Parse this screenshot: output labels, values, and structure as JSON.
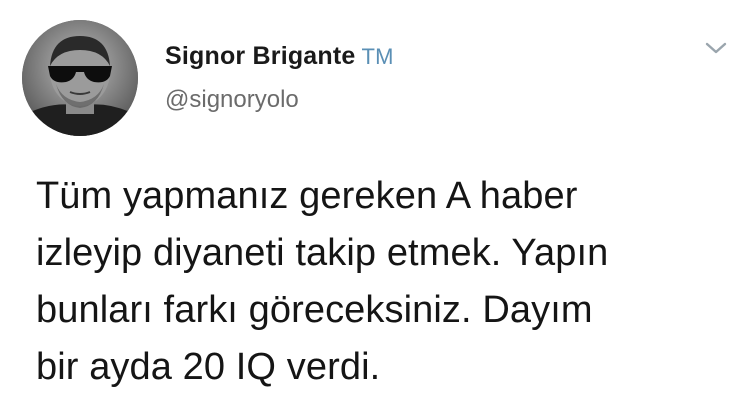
{
  "tweet": {
    "author": {
      "display_name": "Signor Brigante",
      "badge": "TM",
      "handle": "@signoryolo",
      "avatar_icon": "profile-photo-man-sunglasses",
      "badge_color": "#5a8fb5"
    },
    "menu_icon": "chevron-down-icon",
    "text": "Tüm yapmanız gereken A haber\nizleyip diyaneti takip etmek. Yapın\nbunları farkı göreceksiniz. Dayım\nbir ayda 20 IQ verdi."
  }
}
